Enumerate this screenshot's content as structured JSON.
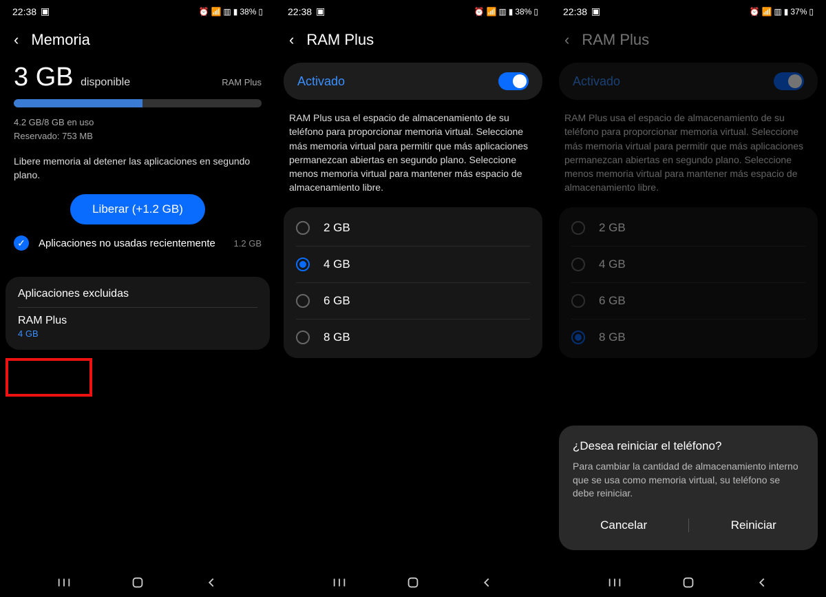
{
  "status": {
    "time": "22:38",
    "battery1": "38%",
    "battery3": "37%"
  },
  "screen1": {
    "title": "Memoria",
    "available_value": "3 GB",
    "available_label": "disponible",
    "ramplus_label": "RAM Plus",
    "usage": "4.2 GB/8 GB en uso",
    "reserved": "Reservado: 753 MB",
    "desc": "Libere memoria al detener las aplicaciones en segundo plano.",
    "free_button": "Liberar (+1.2 GB)",
    "unused_apps": "Aplicaciones no usadas recientemente",
    "unused_size": "1.2 GB",
    "excluded_title": "Aplicaciones excluidas",
    "ramplus_item": "RAM Plus",
    "ramplus_value": "4 GB"
  },
  "screen2": {
    "title": "RAM Plus",
    "activated": "Activado",
    "desc": "RAM Plus usa el espacio de almacenamiento de su teléfono para proporcionar memoria virtual. Seleccione más memoria virtual para permitir que más aplicaciones permanezcan abiertas en segundo plano. Seleccione menos memoria virtual para mantener más espacio de almacenamiento libre.",
    "options": [
      "2 GB",
      "4 GB",
      "6 GB",
      "8 GB"
    ],
    "selected_index": 1
  },
  "screen3": {
    "title": "RAM Plus",
    "activated": "Activado",
    "desc": "RAM Plus usa el espacio de almacenamiento de su teléfono para proporcionar memoria virtual. Seleccione más memoria virtual para permitir que más aplicaciones permanezcan abiertas en segundo plano. Seleccione menos memoria virtual para mantener más espacio de almacenamiento libre.",
    "options": [
      "2 GB",
      "4 GB",
      "6 GB",
      "8 GB"
    ],
    "selected_index": 3,
    "dialog_title": "¿Desea reiniciar el teléfono?",
    "dialog_text": "Para cambiar la cantidad de almacenamiento interno que se usa como memoria virtual, su teléfono se debe reiniciar.",
    "cancel": "Cancelar",
    "restart": "Reiniciar"
  }
}
